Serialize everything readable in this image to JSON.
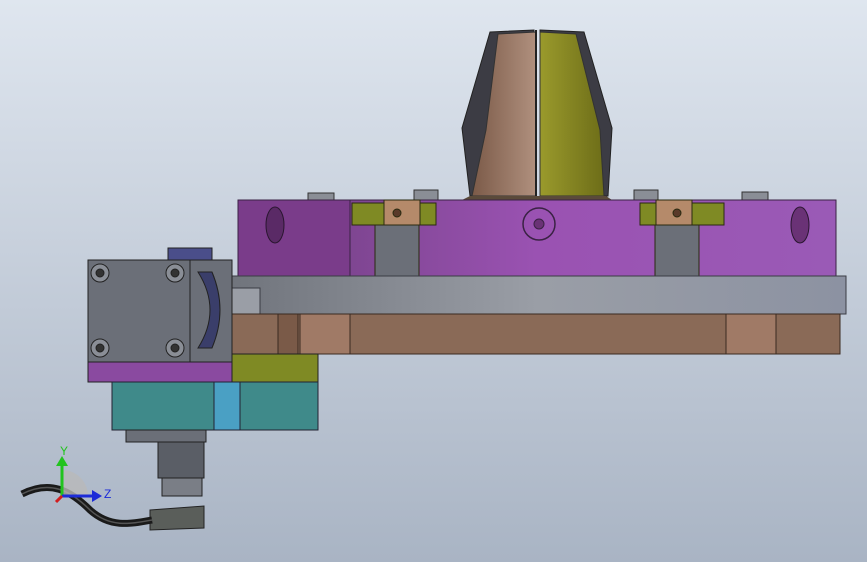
{
  "viewport": {
    "background_top": "#dfe6ef",
    "background_bottom": "#a9b4c4"
  },
  "triad": {
    "y_label": "Y",
    "z_label": "Z",
    "y_color": "#22c31e",
    "z_color": "#1c2bd8",
    "x_color": "#d21e1e"
  },
  "parts": {
    "cone_left_color": "#9a7b69",
    "cone_right_color": "#8a8a24",
    "body_color": "#8a4aa0",
    "ring_color": "#8a8f98",
    "base_color": "#8a6a57",
    "clamp_color": "#7f8a24",
    "block_color": "#6b6f78",
    "teal_color": "#3f8a8a",
    "cable_color": "#1a1a1a"
  }
}
